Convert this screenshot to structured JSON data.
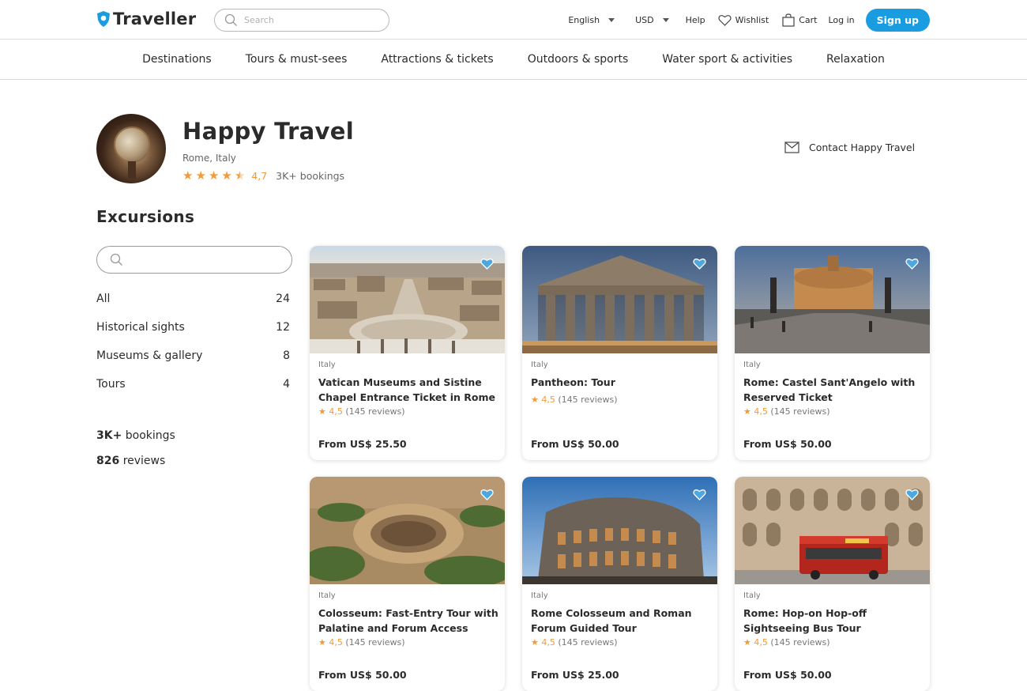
{
  "header": {
    "logo_text": "Traveller",
    "search_placeholder": "Search",
    "language": "English",
    "currency": "USD",
    "help": "Help",
    "wishlist": "Wishlist",
    "cart": "Cart",
    "login": "Log in",
    "signup": "Sign up"
  },
  "nav": [
    "Destinations",
    "Tours & must-sees",
    "Attractions & tickets",
    "Outdoors & sports",
    "Water sport & activities",
    "Relaxation"
  ],
  "profile": {
    "name": "Happy Travel",
    "location": "Rome, Italy",
    "rating": "4,7",
    "rating_value": 4.5,
    "bookings": "3K+ bookings",
    "contact": "Contact Happy Travel"
  },
  "section_title": "Excursions",
  "categories": [
    {
      "label": "All",
      "count": "24"
    },
    {
      "label": "Historical sights",
      "count": "12"
    },
    {
      "label": "Museums & gallery",
      "count": "8"
    },
    {
      "label": "Tours",
      "count": "4"
    }
  ],
  "stats": {
    "bookings_bold": "3K+",
    "bookings_text": "bookings",
    "reviews_bold": "826",
    "reviews_text": "reviews"
  },
  "cards": [
    {
      "country": "Italy",
      "title": "Vatican Museums and Sistine Chapel Entrance Ticket in Rome",
      "rating": "4,5",
      "reviews": "(145 reviews)",
      "price": "From US$ 25.50",
      "accent": "#1a9de0"
    },
    {
      "country": "Italy",
      "title": "Pantheon: Tour",
      "rating": "4,5",
      "reviews": "(145 reviews)",
      "price": "From US$ 50.00",
      "accent": "#1a9de0"
    },
    {
      "country": "Italy",
      "title": "Rome: Castel Sant'Angelo with Reserved Ticket",
      "rating": "4,5",
      "reviews": "(145 reviews)",
      "price": "From US$ 50.00",
      "accent": "#1a9de0"
    },
    {
      "country": "Italy",
      "title": "Colosseum: Fast-Entry Tour with Palatine and Forum Access",
      "rating": "4,5",
      "reviews": "(145 reviews)",
      "price": "From US$ 50.00",
      "accent": "#1a9de0"
    },
    {
      "country": "Italy",
      "title": "Rome Colosseum and Roman Forum  Guided Tour",
      "rating": "4,5",
      "reviews": "(145 reviews)",
      "price": "From US$ 25.00",
      "accent": "#1a9de0"
    },
    {
      "country": "Italy",
      "title": "Rome: Hop-on Hop-off Sightseeing Bus Tour",
      "rating": "4,5",
      "reviews": "(145 reviews)",
      "price": "From US$ 50.00",
      "accent": "#1a9de0"
    }
  ],
  "colors": {
    "brand": "#1a9de0",
    "star": "#f29a38",
    "text": "#2b2b2b"
  }
}
